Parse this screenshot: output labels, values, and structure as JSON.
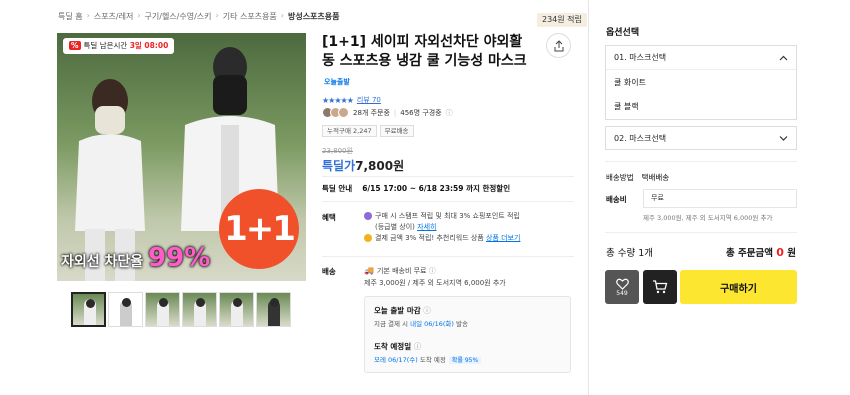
{
  "breadcrumb": [
    "특딜 홈",
    "스포츠/레저",
    "구기/헬스/수영/스키",
    "기타 스포츠용품",
    "방성스포츠용품"
  ],
  "points_tag": "234원 적립",
  "product_image": {
    "timer_prefix": "%",
    "timer_label": "특딜 남은시간",
    "timer_value": "3일 08:00",
    "promo_badge": "1+1",
    "uv_text": "자외선 차단율",
    "uv_value": "99%"
  },
  "thumbnail_count": 6,
  "product": {
    "title": "[1+1] 세이피 자외선차단 야외활동 스포츠용 냉감 쿨 기능성 마스크",
    "delivery_badge": "오늘출발",
    "stars": "★★★★★",
    "review_link": "리뷰 70",
    "buyers_text": "28개 주문중",
    "buyers_sub": "456명 구경중",
    "tag1": "누적구매 2,247",
    "tag2": "무료배송",
    "original_price": "23,800원",
    "price_label": "특딜가",
    "price": "7,800원",
    "deal_label": "특딜 안내",
    "deal_text": "6/15 17:00 ~ 6/18 23:59 까지 한정할인"
  },
  "benefit": {
    "label": "혜택",
    "line1": "구매 시 스탬프 적립 및 최대 3% 쇼핑포인트 적립",
    "line2": "(등급별 상이)",
    "line2_link": "자세히",
    "line3": "결제 금액 3% 적립! 추천리워드 상품",
    "line3_link": "상품 더보기"
  },
  "shipping": {
    "label": "배송",
    "line1": "기본 배송비 무료",
    "line2": "제주 3,000원 / 제주 외 도서지역 6,000원 추가",
    "box_title1": "오늘 출발 마감",
    "box_sub1_prefix": "지금 결제 시",
    "box_sub1_blue": "내일 06/16(화)",
    "box_sub1_suffix": "발송",
    "box_title2": "도착 예정일",
    "box_sub2_blue": "모레 06/17(수)",
    "box_sub2_suffix": "도착 예정",
    "box_chip": "확률 95%"
  },
  "sidebar": {
    "option_title": "옵션선택",
    "option1": "01. 마스크선택",
    "option1_items": [
      "쿨 화이트",
      "쿨 블랙"
    ],
    "option2": "02. 마스크선택",
    "ship_method_label": "배송방법",
    "ship_method_value": "택배배송",
    "fee_label": "배송비",
    "fee_value": "무료",
    "fee_note": "제주 3,000원, 제주 외 도서지역 6,000원 추가",
    "qty_text": "총 수량 1개",
    "total_label": "총 주문금액",
    "total_value": "0",
    "total_unit": "원",
    "like_count": "549",
    "buy_label": "구매하기"
  },
  "colors": {
    "accent_yellow": "#fde630",
    "accent_blue": "#0073e9",
    "promo_orange": "#f0512a",
    "sale_red": "#e22222"
  }
}
